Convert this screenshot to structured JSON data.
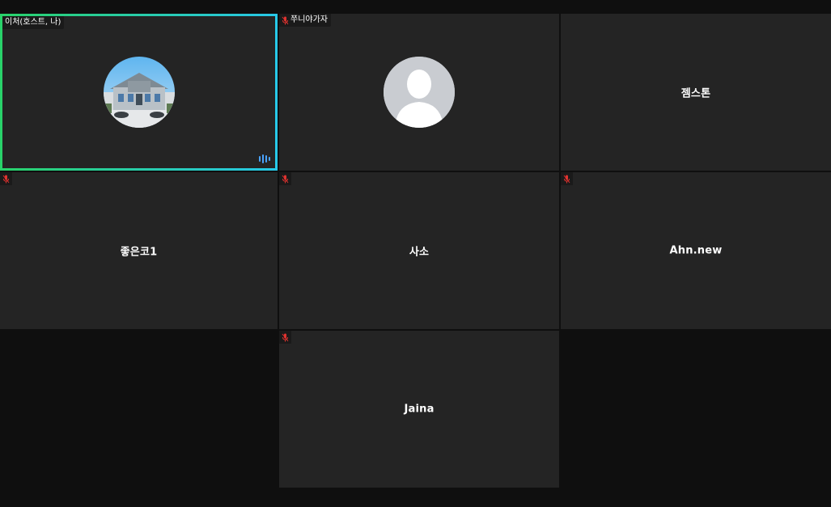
{
  "participants": [
    {
      "name": "이처(호스트, 나)",
      "type": "photo",
      "tag": true,
      "muted": false,
      "active": true
    },
    {
      "name": "쭈니야가자",
      "type": "silhouette",
      "tag": true,
      "muted": true,
      "active": false
    },
    {
      "name": "젬스톤",
      "type": "name",
      "tag": false,
      "muted": false,
      "active": false
    },
    {
      "name": "좋은코1",
      "type": "name",
      "tag": false,
      "muted": true,
      "active": false
    },
    {
      "name": "사소",
      "type": "name",
      "tag": false,
      "muted": true,
      "active": false
    },
    {
      "name": "Ahn.new",
      "type": "name",
      "tag": false,
      "muted": true,
      "active": false
    },
    {
      "name": "Jaina",
      "type": "name",
      "tag": false,
      "muted": true,
      "active": false
    }
  ],
  "colors": {
    "tile_bg": "#242424",
    "active_border_start": "#29d26a",
    "active_border_end": "#27c8e8",
    "mute_icon": "#e0322f",
    "speaking_indicator": "#4aa3ff"
  }
}
